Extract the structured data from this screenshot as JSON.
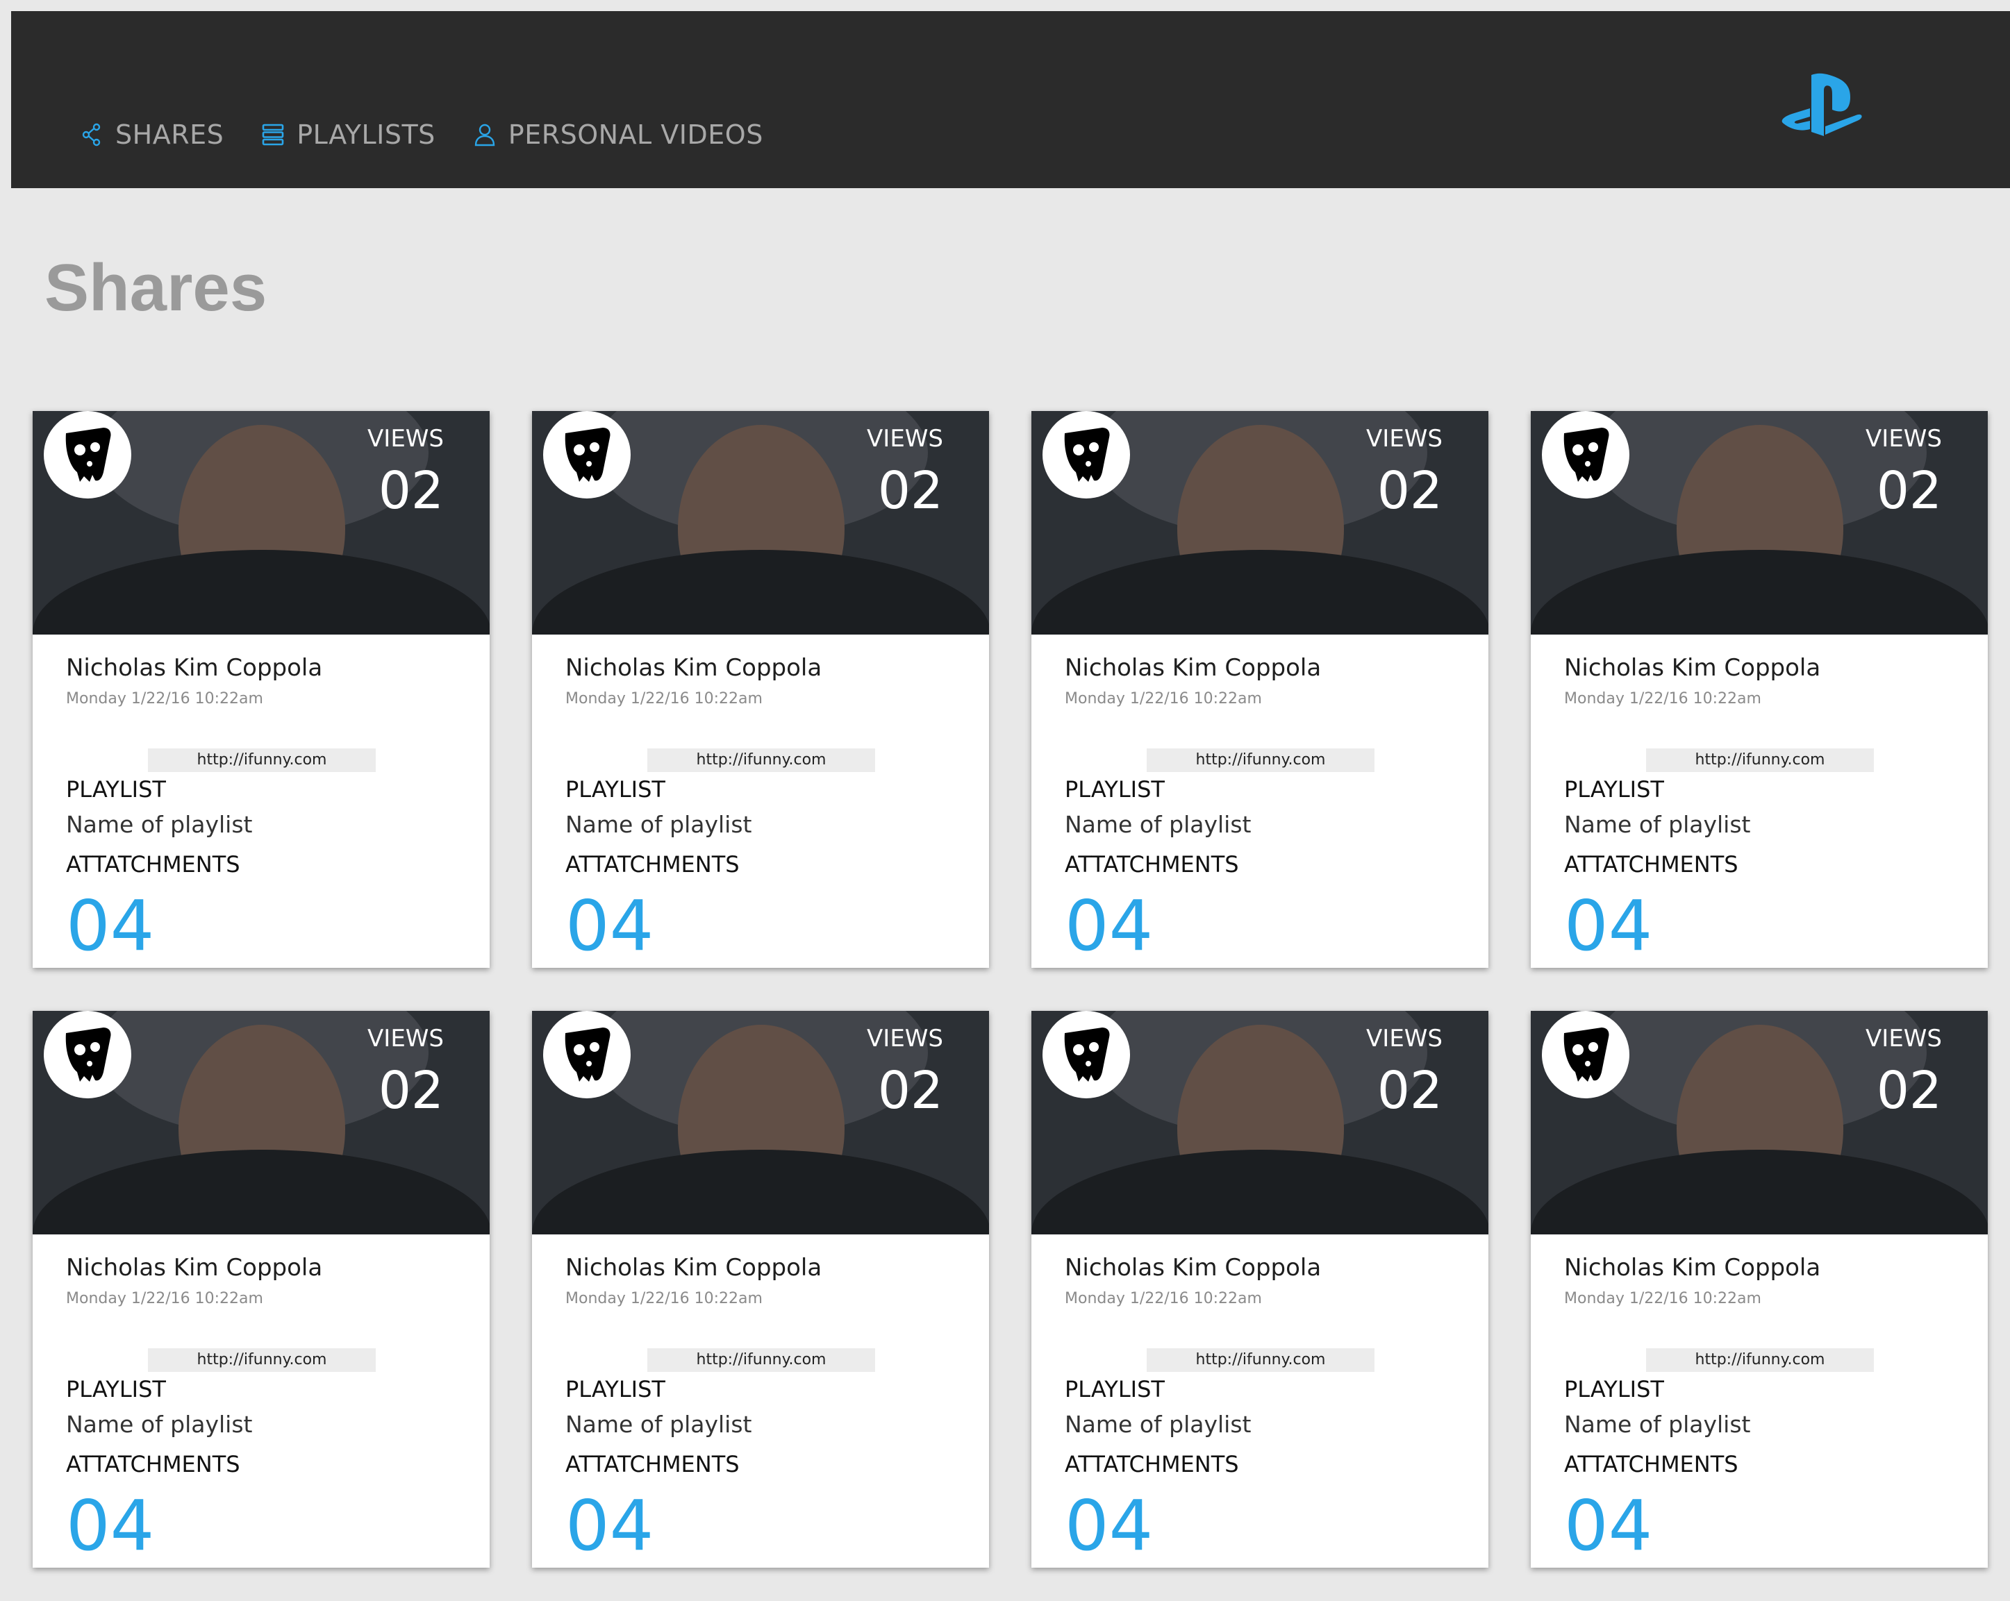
{
  "nav": {
    "items": [
      {
        "label": "SHARES",
        "icon": "share-icon"
      },
      {
        "label": "PLAYLISTS",
        "icon": "list-icon"
      },
      {
        "label": "PERSONAL VIDEOS",
        "icon": "user-icon"
      }
    ],
    "logo": "playstation-logo",
    "accent_color": "#2aa5e8"
  },
  "page": {
    "title": "Shares"
  },
  "cards": [
    {
      "views_label": "VIEWS",
      "views": "02",
      "name": "Nicholas Kim Coppola",
      "date": "Monday 1/22/16 10:22am",
      "url": "http://ifunny.com",
      "playlist_label": "PLAYLIST",
      "playlist_name": "Name of playlist",
      "attachments_label": "ATTATCHMENTS",
      "attachments": "04"
    },
    {
      "views_label": "VIEWS",
      "views": "02",
      "name": "Nicholas Kim Coppola",
      "date": "Monday 1/22/16 10:22am",
      "url": "http://ifunny.com",
      "playlist_label": "PLAYLIST",
      "playlist_name": "Name of playlist",
      "attachments_label": "ATTATCHMENTS",
      "attachments": "04"
    },
    {
      "views_label": "VIEWS",
      "views": "02",
      "name": "Nicholas Kim Coppola",
      "date": "Monday 1/22/16 10:22am",
      "url": "http://ifunny.com",
      "playlist_label": "PLAYLIST",
      "playlist_name": "Name of playlist",
      "attachments_label": "ATTATCHMENTS",
      "attachments": "04"
    },
    {
      "views_label": "VIEWS",
      "views": "02",
      "name": "Nicholas Kim Coppola",
      "date": "Monday 1/22/16 10:22am",
      "url": "http://ifunny.com",
      "playlist_label": "PLAYLIST",
      "playlist_name": "Name of playlist",
      "attachments_label": "ATTATCHMENTS",
      "attachments": "04"
    },
    {
      "views_label": "VIEWS",
      "views": "02",
      "name": "Nicholas Kim Coppola",
      "date": "Monday 1/22/16 10:22am",
      "url": "http://ifunny.com",
      "playlist_label": "PLAYLIST",
      "playlist_name": "Name of playlist",
      "attachments_label": "ATTATCHMENTS",
      "attachments": "04"
    },
    {
      "views_label": "VIEWS",
      "views": "02",
      "name": "Nicholas Kim Coppola",
      "date": "Monday 1/22/16 10:22am",
      "url": "http://ifunny.com",
      "playlist_label": "PLAYLIST",
      "playlist_name": "Name of playlist",
      "attachments_label": "ATTATCHMENTS",
      "attachments": "04"
    },
    {
      "views_label": "VIEWS",
      "views": "02",
      "name": "Nicholas Kim Coppola",
      "date": "Monday 1/22/16 10:22am",
      "url": "http://ifunny.com",
      "playlist_label": "PLAYLIST",
      "playlist_name": "Name of playlist",
      "attachments_label": "ATTATCHMENTS",
      "attachments": "04"
    },
    {
      "views_label": "VIEWS",
      "views": "02",
      "name": "Nicholas Kim Coppola",
      "date": "Monday 1/22/16 10:22am",
      "url": "http://ifunny.com",
      "playlist_label": "PLAYLIST",
      "playlist_name": "Name of playlist",
      "attachments_label": "ATTATCHMENTS",
      "attachments": "04"
    }
  ]
}
